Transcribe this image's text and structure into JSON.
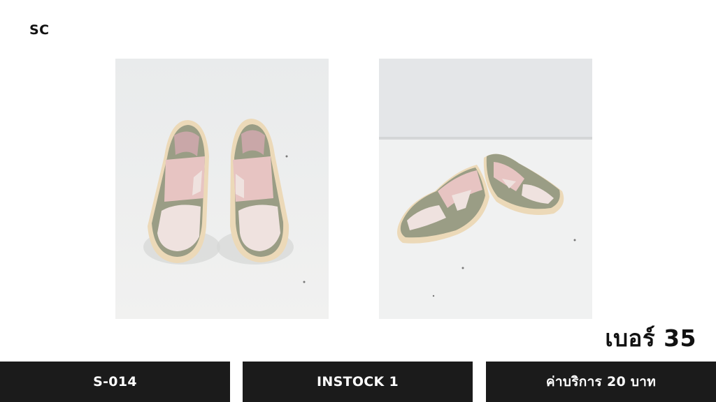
{
  "brand": "SC",
  "photos": [
    {
      "icon": "shoes-front-photo"
    },
    {
      "icon": "shoes-side-photo"
    }
  ],
  "size_label": "เบอร์ 35",
  "info_bar": {
    "code": "S-014",
    "stock": "INSTOCK 1",
    "fee": "ค่าบริการ 20 บาท"
  },
  "colors": {
    "bar_bg": "#1b1b1b",
    "bar_text": "#ffffff",
    "suede": "#9a9d85",
    "mesh": "#efe2df",
    "strap": "#e7c4c2",
    "sole": "#ecd9b8"
  }
}
